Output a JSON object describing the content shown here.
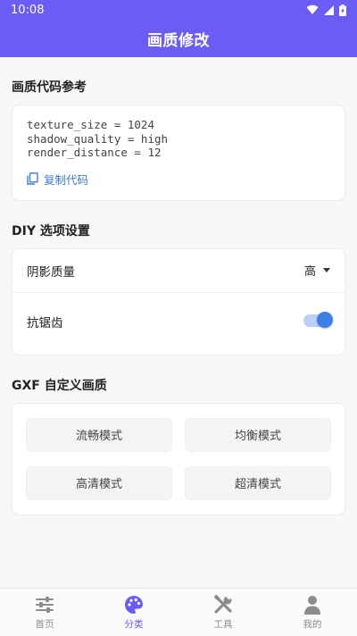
{
  "status": {
    "time": "10:08"
  },
  "appbar": {
    "title": "画质修改"
  },
  "sections": {
    "code": {
      "title": "画质代码参考",
      "lines": [
        "texture_size = 1024",
        "shadow_quality = high",
        "render_distance = 12"
      ],
      "copy_label": "复制代码"
    },
    "diy": {
      "title": "DIY 选项设置",
      "shadow_label": "阴影质量",
      "shadow_value": "高",
      "aa_label": "抗锯齿",
      "aa_enabled": true
    },
    "gxf": {
      "title": "GXF 自定义画质",
      "modes": [
        "流畅模式",
        "均衡模式",
        "高清模式",
        "超清模式"
      ]
    }
  },
  "nav": {
    "items": [
      {
        "label": "首页",
        "icon": "sliders-icon",
        "active": false
      },
      {
        "label": "分类",
        "icon": "palette-icon",
        "active": true
      },
      {
        "label": "工具",
        "icon": "tools-icon",
        "active": false
      },
      {
        "label": "我的",
        "icon": "person-icon",
        "active": false
      }
    ]
  },
  "colors": {
    "primary": "#6a5cf4",
    "accent": "#3d7fe4"
  }
}
